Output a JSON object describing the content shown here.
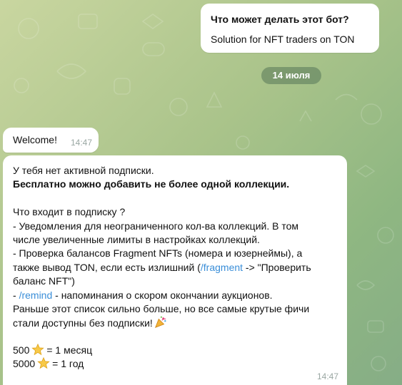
{
  "bot_card": {
    "title": "Что может делать этот бот?",
    "description": "Solution for NFT traders on TON"
  },
  "date_badge": "14 июля",
  "messages": [
    {
      "text": "Welcome!",
      "time": "14:47"
    },
    {
      "time": "14:47",
      "status_line": "У тебя нет активной подписки.",
      "free_line": "Бесплатно можно добавить не более одной коллекции.",
      "includes_title": "Что входит в подписку ?",
      "feature1_line1": "- Уведомления для неограниченного кол-ва коллекций. В том",
      "feature1_line2": "числе увеличенные лимиты в настройках коллекций.",
      "feature2_line1": "- Проверка балансов Fragment NFTs (номера и юзернеймы), а",
      "feature2_line2_pre": "также вывод TON, если есть излишний (",
      "feature2_link": "/fragment",
      "feature2_line2_post": " -> \"Проверить",
      "feature2_line3": "баланс NFT\")",
      "feature3_pre": "- ",
      "feature3_link": "/remind",
      "feature3_post": " - напоминания о скором окончании аукционов.",
      "note_line1": "Раньше этот список сильно больше, но все самые крутые фичи",
      "note_line2": "стали доступны без подписки!",
      "price1_amount": "500",
      "price1_period": "= 1 месяц",
      "price2_amount": "5000",
      "price2_period": "= 1 год"
    }
  ]
}
